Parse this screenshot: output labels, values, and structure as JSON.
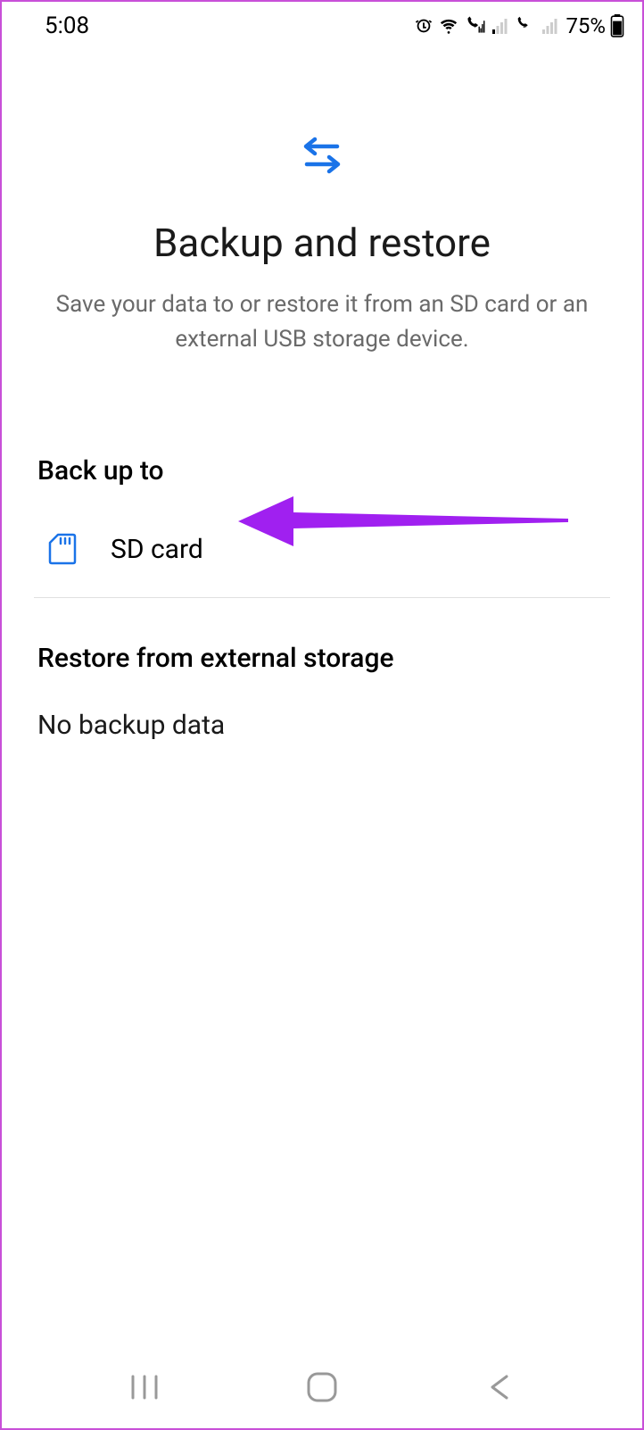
{
  "status": {
    "time": "5:08",
    "battery_pct": "75%"
  },
  "header": {
    "title": "Backup and restore",
    "subtitle": "Save your data to or restore it from an SD card or an external USB storage device."
  },
  "backup": {
    "heading": "Back up to",
    "item_label": "SD card"
  },
  "restore": {
    "heading": "Restore from external storage",
    "body": "No backup data"
  },
  "colors": {
    "accent": "#1a73e8",
    "annotation": "#a020f0"
  }
}
